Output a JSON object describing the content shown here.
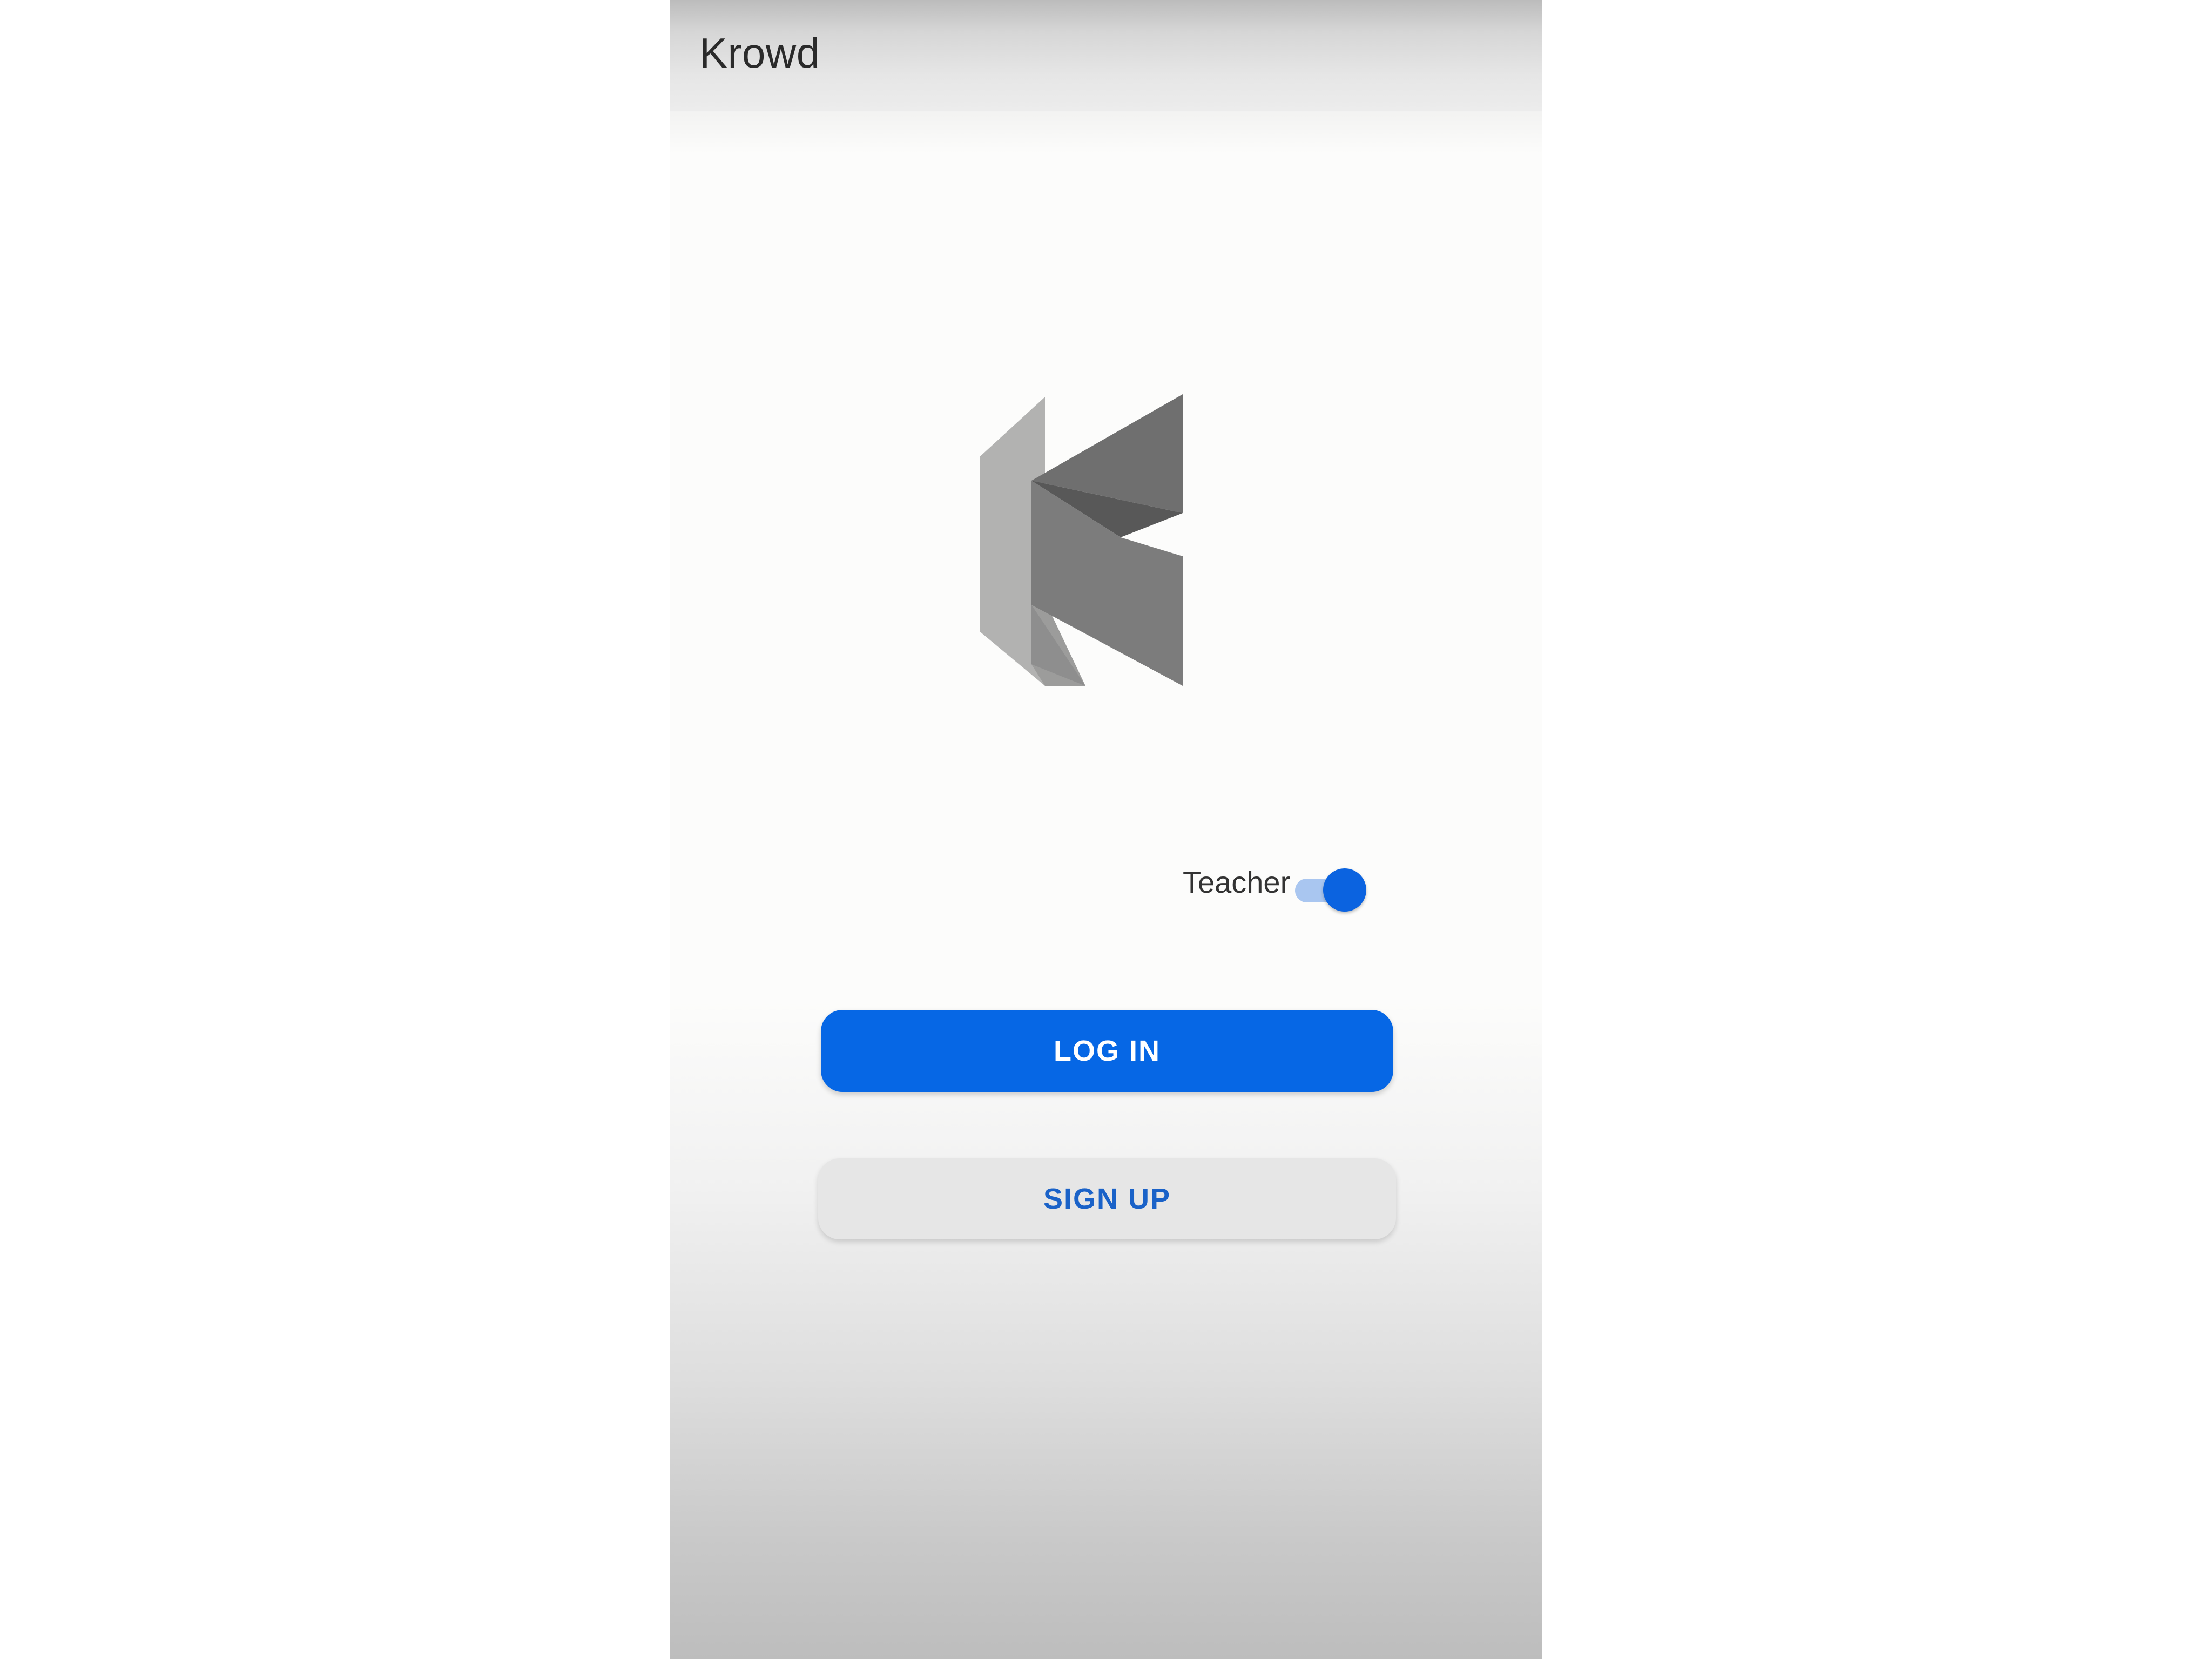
{
  "app_bar": {
    "title": "Krowd"
  },
  "logo": {
    "name": "krowd-logo-icon"
  },
  "role_toggle": {
    "label": "Teacher",
    "checked": true,
    "color": "#0b63e0",
    "track_color": "#a9c6f0"
  },
  "actions": {
    "login_label": "LOG IN",
    "signup_label": "SIGN UP",
    "primary_color": "#0667e5",
    "secondary_text_color": "#1a62c8"
  }
}
